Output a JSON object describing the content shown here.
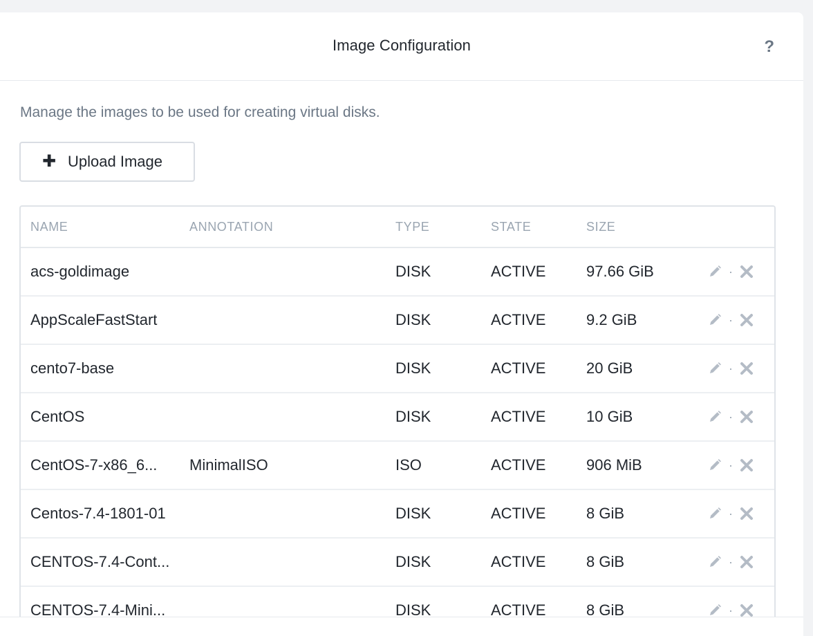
{
  "dialog": {
    "title": "Image Configuration",
    "help_icon": "?"
  },
  "body": {
    "description": "Manage the images to be used for creating virtual disks.",
    "upload_button": {
      "icon": "plus-icon",
      "label": "Upload Image"
    }
  },
  "table": {
    "columns": {
      "name": "NAME",
      "annotation": "ANNOTATION",
      "type": "TYPE",
      "state": "STATE",
      "size": "SIZE"
    },
    "row_action_icons": [
      "pencil-icon",
      "close-icon"
    ],
    "action_separator": "·",
    "rows": [
      {
        "name": "acs-goldimage",
        "annotation": "",
        "type": "DISK",
        "state": "ACTIVE",
        "size": "97.66 GiB"
      },
      {
        "name": "AppScaleFastStart",
        "annotation": "",
        "type": "DISK",
        "state": "ACTIVE",
        "size": "9.2 GiB"
      },
      {
        "name": "cento7-base",
        "annotation": "",
        "type": "DISK",
        "state": "ACTIVE",
        "size": "20 GiB"
      },
      {
        "name": "CentOS",
        "annotation": "",
        "type": "DISK",
        "state": "ACTIVE",
        "size": "10 GiB"
      },
      {
        "name": "CentOS-7-x86_6...",
        "annotation": "MinimalISO",
        "type": "ISO",
        "state": "ACTIVE",
        "size": "906 MiB"
      },
      {
        "name": "Centos-7.4-1801-01",
        "annotation": "",
        "type": "DISK",
        "state": "ACTIVE",
        "size": "8 GiB"
      },
      {
        "name": "CENTOS-7.4-Cont...",
        "annotation": "",
        "type": "DISK",
        "state": "ACTIVE",
        "size": "8 GiB"
      },
      {
        "name": "CENTOS-7.4-Mini...",
        "annotation": "",
        "type": "DISK",
        "state": "ACTIVE",
        "size": "8 GiB"
      }
    ]
  },
  "colors": {
    "text": "#22272e",
    "muted": "#6b7785",
    "header_label": "#9aa5b1",
    "border": "#dfe3e8",
    "icon": "#b4bcc6"
  }
}
